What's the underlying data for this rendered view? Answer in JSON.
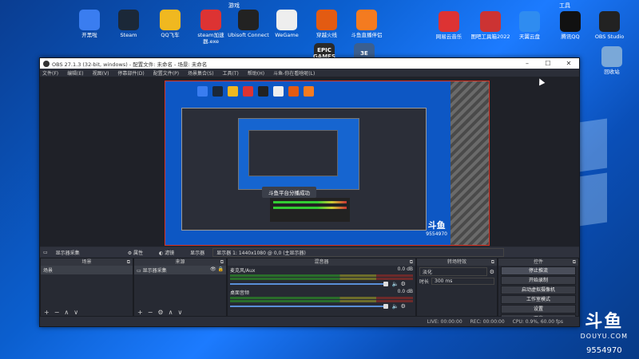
{
  "desktop": {
    "group_games": "游戏",
    "group_tools": "工具",
    "icons_row1": [
      {
        "label": "开黑啦",
        "color": "#3a7df0"
      },
      {
        "label": "Steam",
        "color": "#1b2838"
      },
      {
        "label": "QQ飞车",
        "color": "#f0b820"
      },
      {
        "label": "steam加速器.exe",
        "color": "#d33"
      },
      {
        "label": "Ubisoft Connect",
        "color": "#222"
      },
      {
        "label": "WeGame",
        "color": "#eee"
      },
      {
        "label": "穿越火线",
        "color": "#e35b12"
      },
      {
        "label": "斗鱼直播伴侣",
        "color": "#f47b20"
      }
    ],
    "icons_row2": [
      {
        "label": "EPIC GAMES",
        "color": "#2a2a2a"
      },
      {
        "label": "3E",
        "color": "#3b5f8f"
      }
    ],
    "tool_icons": [
      {
        "label": "网易云音乐",
        "color": "#d33"
      },
      {
        "label": "图吧工具箱2022",
        "color": "#c33"
      },
      {
        "label": "天翼云盘",
        "color": "#2f8cf0"
      },
      {
        "label": "腾讯QQ",
        "color": "#111"
      },
      {
        "label": "OBS Studio",
        "color": "#222"
      },
      {
        "label": "回收站",
        "color": "#7aa8d8"
      }
    ],
    "douyu_logo": "斗鱼",
    "douyu_sub": "DOUYU.COM",
    "room_id": "9554970"
  },
  "obs": {
    "title": "OBS 27.1.3 (32-bit, windows) - 配置文件: 未命名 - 场景: 未命名",
    "menu": [
      "文件(F)",
      "编辑(E)",
      "视图(V)",
      "停靠部件(D)",
      "配置文件(P)",
      "场景集合(S)",
      "工具(T)",
      "帮助(H)",
      "斗鱼-你在看啥呢(L)"
    ],
    "ctx_source": "显示器采集",
    "ctx_props": "属性",
    "ctx_filters": "滤镜",
    "ctx_display_label": "显示器",
    "ctx_display_value": "显示器 1: 1440x1080 @ 0,0 (主显示器)",
    "toast": "斗鱼平台分播成功",
    "preview_logo": "斗鱼",
    "preview_id": "9554970",
    "scenes": {
      "header": "场景",
      "items": [
        "场景"
      ]
    },
    "sources": {
      "header": "来源",
      "items": [
        "显示器采集"
      ]
    },
    "mixer": {
      "header": "混音器",
      "channels": [
        {
          "name": "麦克风/Aux",
          "db": "0.0 dB"
        },
        {
          "name": "桌面音频",
          "db": "0.0 dB"
        }
      ]
    },
    "transitions": {
      "header": "转场特效",
      "type": "淡化",
      "duration_label": "时长",
      "duration": "300 ms"
    },
    "controls": {
      "header": "控件",
      "buttons": [
        "停止推流",
        "开始录制",
        "启动虚拟摄像机",
        "工作室模式",
        "设置",
        "退出"
      ]
    },
    "status": {
      "live": "LIVE: 00:00:00",
      "rec": "REC: 00:00:00",
      "cpu": "CPU: 0.9%, 60.00 fps"
    }
  }
}
